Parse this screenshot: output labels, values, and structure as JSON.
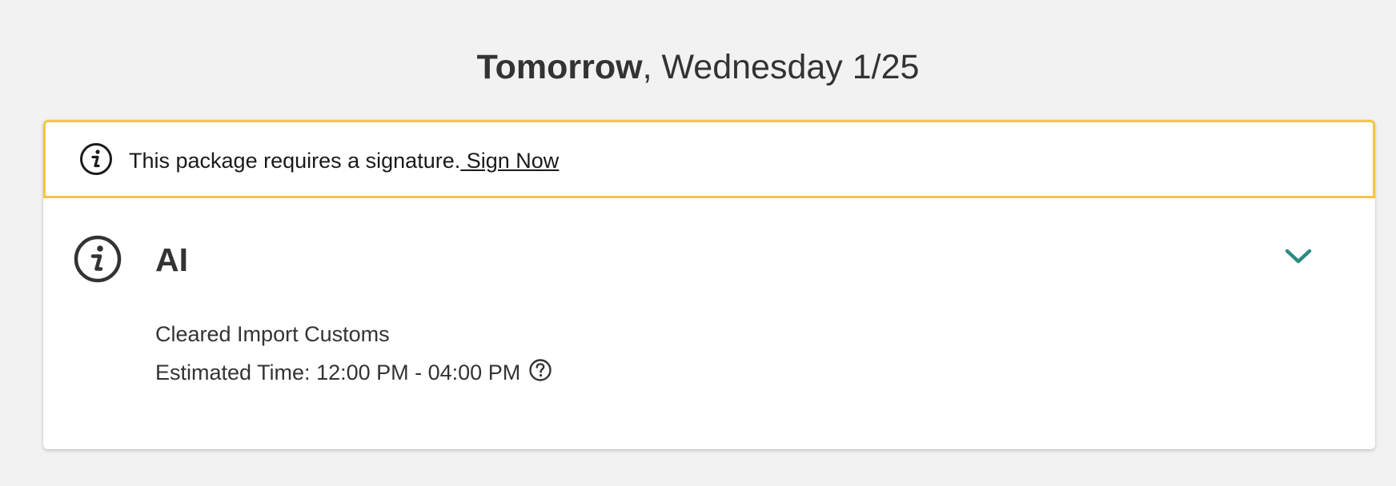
{
  "header": {
    "day": "Tomorrow",
    "date": ", Wednesday 1/25"
  },
  "alert": {
    "icon": "info-icon",
    "message": "This package requires a signature.",
    "link_label": " Sign Now",
    "border_color": "#f4c542"
  },
  "status": {
    "icon": "info-icon",
    "title": "AI",
    "description": "Cleared Import Customs",
    "estimated_time": "Estimated Time: 12:00 PM - 04:00 PM",
    "help_icon": "question-circle-icon",
    "expand_icon": "chevron-down-icon",
    "accent_color": "#2e8b84"
  }
}
